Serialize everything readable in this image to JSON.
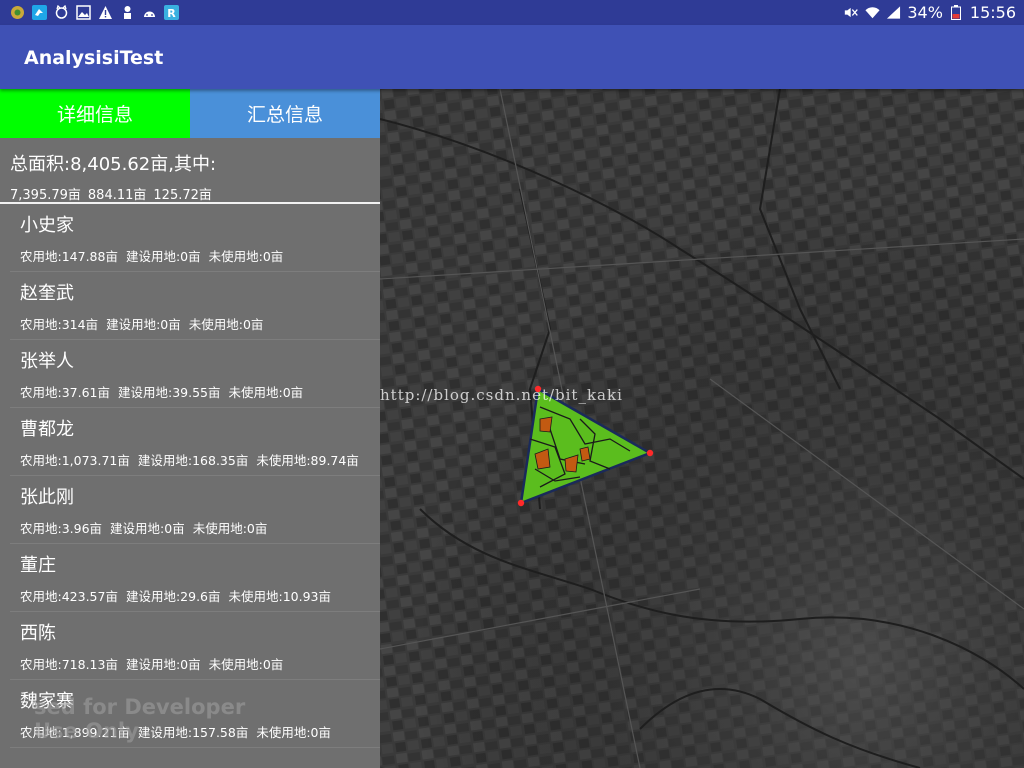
{
  "statusbar": {
    "battery_percent": "34%",
    "time": "15:56",
    "left_icons": [
      "android-debug-icon",
      "bird-icon",
      "cat-icon",
      "image-icon",
      "warning-icon",
      "android-robot-icon",
      "android-face-icon",
      "r-app-icon"
    ],
    "right_icons": [
      "mute-icon",
      "wifi-icon",
      "signal-icon",
      "battery-icon"
    ]
  },
  "app": {
    "title": "AnalysisiTest"
  },
  "tabs": [
    {
      "label": "详细信息",
      "active": true,
      "color": "#00ff00"
    },
    {
      "label": "汇总信息",
      "active": false,
      "color": "#4a90d9"
    }
  ],
  "summary": {
    "total": "总面积:8,405.62亩,其中:",
    "parts": [
      "7,395.79亩",
      "884.11亩",
      "125.72亩"
    ]
  },
  "villages": [
    {
      "name": "小史家",
      "farm": "农用地:147.88亩",
      "build": "建设用地:0亩",
      "unused": "未使用地:0亩"
    },
    {
      "name": "赵奎武",
      "farm": "农用地:314亩",
      "build": "建设用地:0亩",
      "unused": "未使用地:0亩"
    },
    {
      "name": "张举人",
      "farm": "农用地:37.61亩",
      "build": "建设用地:39.55亩",
      "unused": "未使用地:0亩"
    },
    {
      "name": "曹都龙",
      "farm": "农用地:1,073.71亩",
      "build": "建设用地:168.35亩",
      "unused": "未使用地:89.74亩"
    },
    {
      "name": "张此刚",
      "farm": "农用地:3.96亩",
      "build": "建设用地:0亩",
      "unused": "未使用地:0亩"
    },
    {
      "name": "董庄",
      "farm": "农用地:423.57亩",
      "build": "建设用地:29.6亩",
      "unused": "未使用地:10.93亩"
    },
    {
      "name": "西陈",
      "farm": "农用地:718.13亩",
      "build": "建设用地:0亩",
      "unused": "未使用地:0亩"
    },
    {
      "name": "魏家寨",
      "farm": "农用地:1,899.21亩",
      "build": "建设用地:157.58亩",
      "unused": "未使用地:0亩"
    }
  ],
  "map": {
    "watermark": "http://blog.csdn.net/bit_kaki",
    "developer_watermark": [
      "sed for Developer",
      "Use Only"
    ],
    "polygon_fill": "#5bbd1e",
    "vertex_color": "#ff2a2a"
  }
}
